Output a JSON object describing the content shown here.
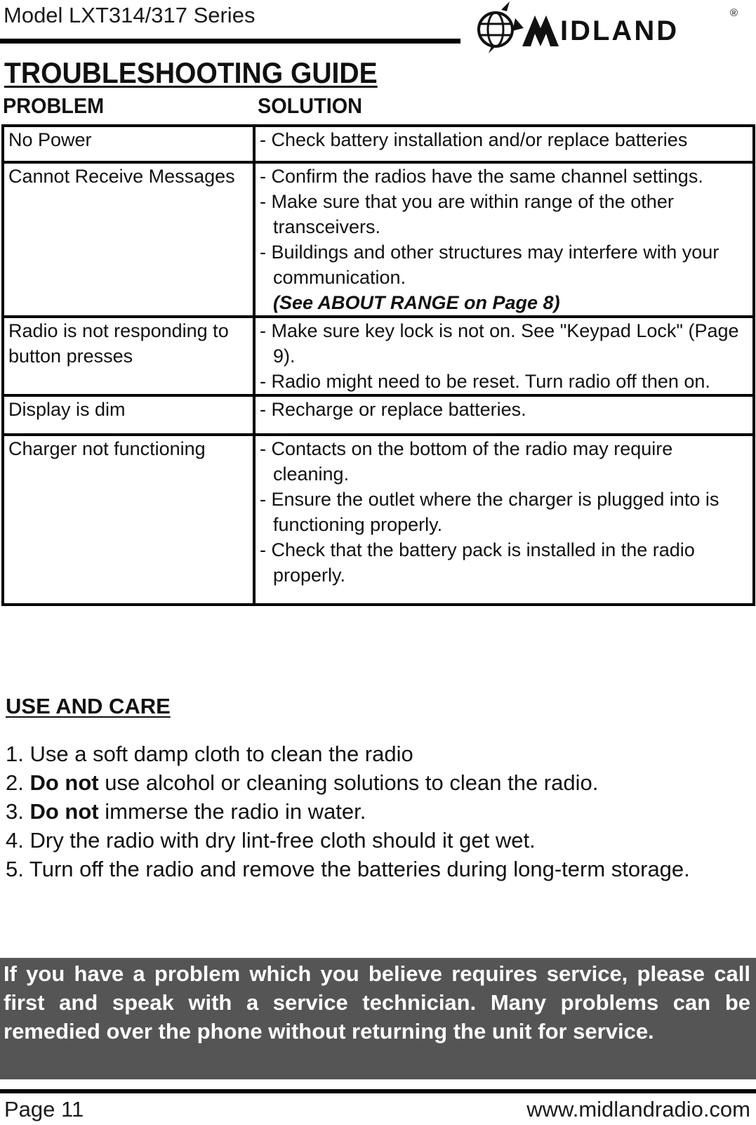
{
  "header": {
    "model_title": "Model LXT314/317 Series",
    "brand": "MIDLAND",
    "brand_icon": "globe-logo-icon",
    "registered_mark": "®"
  },
  "title": "TROUBLESHOOTING GUIDE",
  "columns": {
    "problem": "PROBLEM",
    "solution": "SOLUTION"
  },
  "rows": [
    {
      "problem": "No Power",
      "solutions": [
        "- Check battery installation and/or replace batteries"
      ],
      "note": null
    },
    {
      "problem": "Cannot Receive Messages",
      "solutions": [
        "- Confirm the radios have the same channel settings.",
        "- Make sure that you are within range of the other transceivers.",
        "- Buildings and other structures may interfere with your communication."
      ],
      "note": "(See ABOUT RANGE on Page 8)"
    },
    {
      "problem": "Radio is not responding to button presses",
      "solutions": [
        "- Make sure key lock is not on. See \"Keypad Lock\" (Page 9).",
        "- Radio might need to be reset.  Turn radio off then on."
      ],
      "note": null
    },
    {
      "problem": "Display is dim",
      "solutions": [
        "- Recharge or replace batteries."
      ],
      "note": null
    },
    {
      "problem": "Charger not functioning",
      "solutions": [
        "- Contacts on the bottom of the radio may require cleaning.",
        "- Ensure the outlet where the charger is plugged into is functioning properly.",
        "- Check that the battery pack is installed in the radio properly."
      ],
      "note": null
    }
  ],
  "care": {
    "title": "USE AND CARE",
    "items": [
      {
        "num": "1.",
        "bold": "",
        "text": "Use a soft damp cloth to clean the radio"
      },
      {
        "num": "2.",
        "bold": "Do not",
        "text": " use alcohol or cleaning solutions to clean the radio."
      },
      {
        "num": "3.",
        "bold": "Do not",
        "text": " immerse the radio in water."
      },
      {
        "num": "4.",
        "bold": "",
        "text": "Dry the radio with dry lint-free cloth should it get wet."
      },
      {
        "num": "5.",
        "bold": "",
        "text": "Turn off the radio and remove the batteries during long-term storage."
      }
    ]
  },
  "service_notice": "If you have a problem which you believe requires service, please call first and speak with a service technician.  Many problems can be remedied over the phone without returning the unit for service.",
  "footer": {
    "page": "Page 11",
    "url": "www.midlandradio.com"
  },
  "colors": {
    "text": "#111111",
    "rule": "#000000",
    "notice_bg": "#555555",
    "notice_text": "#ffffff"
  }
}
